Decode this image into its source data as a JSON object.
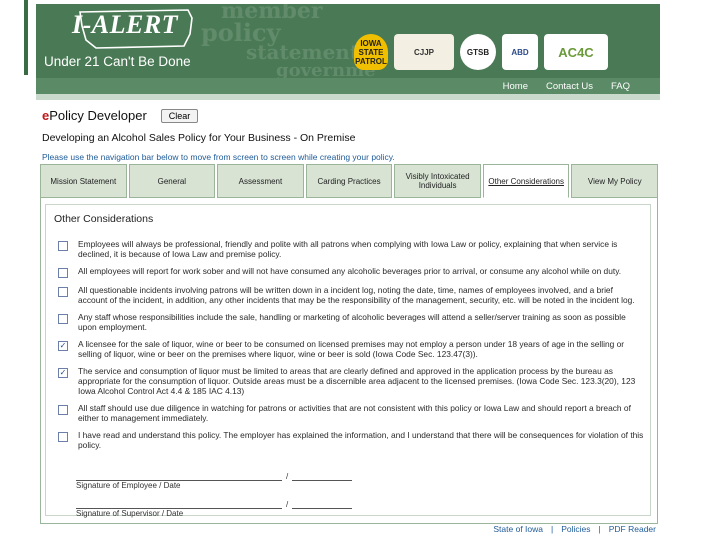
{
  "banner": {
    "logo_text": "I-ALERT",
    "tagline": "Under 21 Can't Be Done",
    "background_words": [
      "member",
      "policy",
      "statement",
      "governme"
    ],
    "seals": [
      {
        "name": "iowa-state-patrol-seal",
        "label": "IOWA STATE PATROL"
      },
      {
        "name": "cjjp-seal",
        "label": "CJJP"
      },
      {
        "name": "gtsb-seal",
        "label": "GTSB"
      },
      {
        "name": "abd-seal",
        "label": "ABD"
      },
      {
        "name": "ac4c-seal",
        "label": "AC4C"
      }
    ]
  },
  "topnav": {
    "home": "Home",
    "contact": "Contact Us",
    "faq": "FAQ"
  },
  "app": {
    "title_e": "e",
    "title_rest": "Policy Developer",
    "clear_label": "Clear",
    "subtitle": "Developing an Alcohol Sales Policy for Your Business - On Premise",
    "instruction": "Please use the navigation bar below to move from screen to screen while creating your policy."
  },
  "tabs": [
    {
      "label": "Mission Statement",
      "active": false
    },
    {
      "label": "General",
      "active": false
    },
    {
      "label": "Assessment",
      "active": false
    },
    {
      "label": "Carding Practices",
      "active": false
    },
    {
      "label": "Visibly Intoxicated Individuals",
      "active": false
    },
    {
      "label": "Other Considerations",
      "active": true
    },
    {
      "label": "View My Policy",
      "active": false
    }
  ],
  "section_title": "Other Considerations",
  "items": [
    {
      "checked": false,
      "text": "Employees will always be professional, friendly and polite with all patrons when complying with Iowa Law or policy, explaining that when service is declined, it is because of Iowa Law and premise policy."
    },
    {
      "checked": false,
      "text": "All employees will report for work sober and will not have consumed any alcoholic beverages prior to arrival, or consume any alcohol while on duty."
    },
    {
      "checked": false,
      "text": "All questionable incidents involving patrons will be written down in a incident log, noting the date, time, names of employees involved, and a brief account of the incident, in addition, any other incidents that may be the responsibility of the management, security, etc. will be noted in the incident log."
    },
    {
      "checked": false,
      "text": "Any staff whose responsibilities include the sale, handling or marketing of alcoholic beverages will attend a seller/server training as soon as possible upon employment."
    },
    {
      "checked": true,
      "text": "A licensee for the sale of liquor, wine or beer to be consumed on licensed premises may not employ a person under 18 years of age in the selling or selling of liquor, wine or beer on the premises where liquor, wine or beer is sold (Iowa Code Sec. 123.47(3))."
    },
    {
      "checked": true,
      "text": "The service and consumption of liquor must be limited to areas that are clearly defined and approved in the application process by the bureau as appropriate for the consumption of liquor. Outside areas must be a discernible area adjacent to the licensed premises. (Iowa Code Sec. 123.3(20), 123 Iowa Alcohol Control Act 4.4 & 185 IAC 4.13)"
    },
    {
      "checked": false,
      "text": "All staff should use due diligence in watching for patrons or activities that are not consistent with this policy or Iowa Law and should report a breach of either to management immediately."
    },
    {
      "checked": false,
      "text": "I have read and understand this policy. The employer has explained the information, and I understand that there will be consequences for violation of this policy."
    }
  ],
  "signatures": [
    {
      "label": "Signature of Employee / Date"
    },
    {
      "label": "Signature of Supervisor / Date"
    }
  ],
  "footer": {
    "state": "State of Iowa",
    "policies": "Policies",
    "pdf": "PDF Reader",
    "sep": "|"
  }
}
